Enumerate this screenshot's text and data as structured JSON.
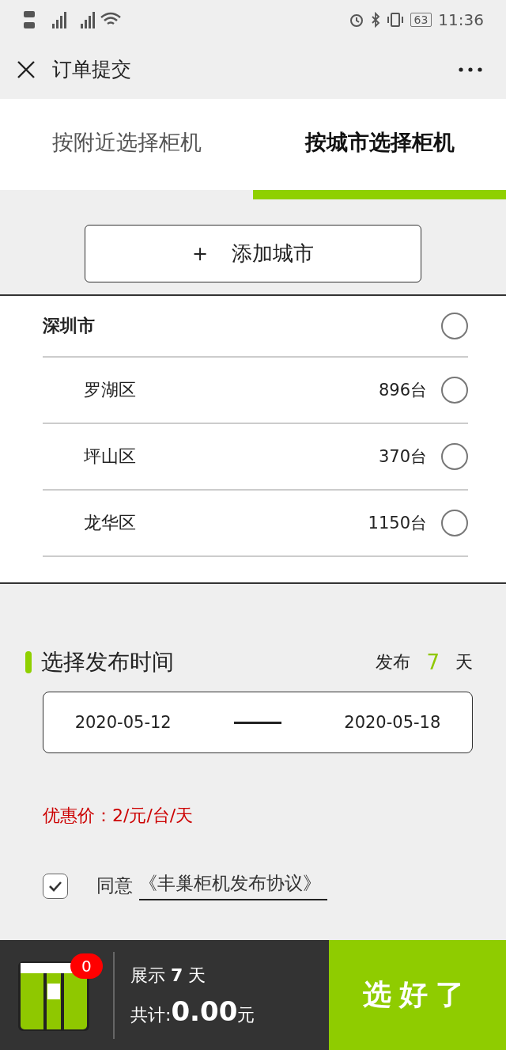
{
  "status_bar": {
    "battery": "63",
    "time": "11:36"
  },
  "nav": {
    "title": "订单提交"
  },
  "tabs": [
    {
      "label": "按附近选择柜机",
      "selected": false
    },
    {
      "label": "按城市选择柜机",
      "selected": true
    }
  ],
  "add_city": {
    "icon": "+",
    "label": "添加城市"
  },
  "city": {
    "name": "深圳市",
    "checked": false,
    "districts": [
      {
        "name": "罗湖区",
        "count": "896台",
        "checked": false
      },
      {
        "name": "坪山区",
        "count": "370台",
        "checked": false
      },
      {
        "name": "龙华区",
        "count": "1150台",
        "checked": false
      }
    ]
  },
  "publish": {
    "title": "选择发布时间",
    "prefix": "发布",
    "days": "7",
    "suffix": "天",
    "start": "2020-05-12",
    "end": "2020-05-18"
  },
  "price": "优惠价：2/元/台/天",
  "agree": {
    "checked": true,
    "label": "同意",
    "link": "《丰巢柜机发布协议》"
  },
  "footer": {
    "badge": "0",
    "show_label": "展示",
    "show_days": "7",
    "show_unit": "天",
    "total_label": "共计:",
    "total": "0.00",
    "total_unit": "元",
    "confirm": "选好了"
  }
}
